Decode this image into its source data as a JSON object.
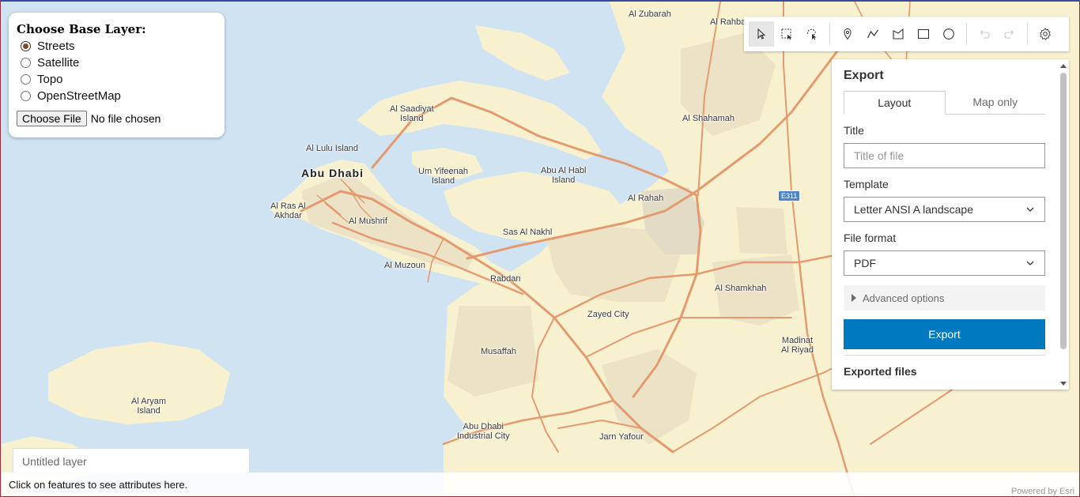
{
  "base_layer_panel": {
    "heading": "Choose Base Layer:",
    "options": [
      {
        "label": "Streets",
        "checked": true
      },
      {
        "label": "Satellite",
        "checked": false
      },
      {
        "label": "Topo",
        "checked": false
      },
      {
        "label": "OpenStreetMap",
        "checked": false
      }
    ],
    "file_button": "Choose File",
    "file_status": "No file chosen"
  },
  "toolbar": {
    "tools": [
      "select-pointer-icon",
      "rectangle-select-icon",
      "lasso-select-icon",
      "point-icon",
      "polyline-icon",
      "polygon-icon",
      "rectangle-icon",
      "circle-icon",
      "undo-icon",
      "redo-icon",
      "settings-gear-icon"
    ]
  },
  "export_panel": {
    "title": "Export",
    "tabs": [
      {
        "label": "Layout",
        "active": true
      },
      {
        "label": "Map only",
        "active": false
      }
    ],
    "title_label": "Title",
    "title_placeholder": "Title of file",
    "template_label": "Template",
    "template_value": "Letter ANSI A landscape",
    "format_label": "File format",
    "format_value": "PDF",
    "advanced_label": "Advanced options",
    "export_button": "Export",
    "exported_files_label": "Exported files"
  },
  "map": {
    "labels": {
      "al_zubarah": "Al Zubarah",
      "al_rahba": "Al Rahba",
      "al_saadiyat_1": "Al Saadiyat",
      "al_saadiyat_2": "Island",
      "al_shahamah": "Al Shahamah",
      "al_lulu_1": "Al Lulu Island",
      "abu_dhabi": "Abu Dhabi",
      "um_yifeenah_1": "Um Yifeenah",
      "um_yifeenah_2": "Island",
      "abu_al_habl_1": "Abu Al Habl",
      "abu_al_habl_2": "Island",
      "al_rahah": "Al Rahah",
      "al_ras_1": "Al Ras Al",
      "al_ras_2": "Akhdar",
      "al_mushrif": "Al Mushrif",
      "sas_al_nakhl": "Sas Al Nakhl",
      "al_muzoun": "Al Muzoun",
      "rabdan": "Rabdan",
      "al_shamkhah": "Al Shamkhah",
      "zayed_city": "Zayed City",
      "musaffah": "Musaffah",
      "madinat_1": "Madinat",
      "madinat_2": "Al Riyad",
      "al_aryam_1": "Al Aryam",
      "al_aryam_2": "Island",
      "icad_1": "Abu Dhabi",
      "icad_2": "Industrial City",
      "jarn_yafour": "Jarn Yafour",
      "shield": "E311"
    },
    "colors": {
      "water": "#cfe3f3",
      "land": "#f8f1cf",
      "urban": "#ece3c6",
      "road": "#e49a6e"
    }
  },
  "layer_box": {
    "placeholder": "Untitled layer"
  },
  "footer": {
    "text": "Click on features to see attributes here."
  },
  "attribution": "Powered by Esri"
}
